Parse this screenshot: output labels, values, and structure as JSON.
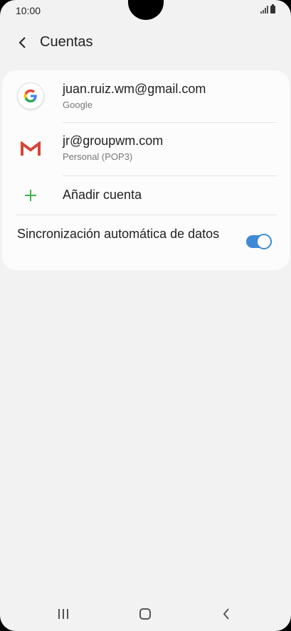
{
  "status_bar": {
    "time": "10:00"
  },
  "header": {
    "title": "Cuentas"
  },
  "accounts": [
    {
      "title": "juan.ruiz.wm@gmail.com",
      "subtitle": "Google",
      "icon": "google-icon"
    },
    {
      "title": "jr@groupwm.com",
      "subtitle": "Personal (POP3)",
      "icon": "gmail-icon"
    }
  ],
  "add_account": {
    "label": "Añadir cuenta",
    "icon": "plus-icon"
  },
  "auto_sync": {
    "label": "Sincronización automática de datos",
    "enabled": true
  },
  "colors": {
    "accent": "#3e8ad6",
    "plus": "#3bb54a",
    "gmail_red": "#d44638"
  },
  "nav": {
    "icons": [
      "recents-icon",
      "home-icon",
      "back-icon"
    ]
  }
}
